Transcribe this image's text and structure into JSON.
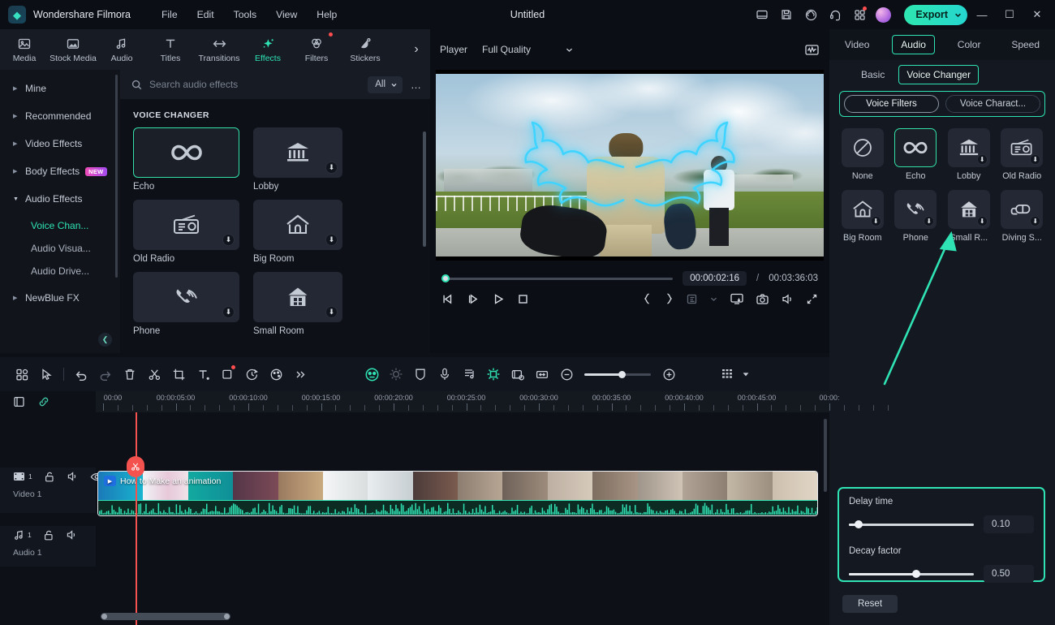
{
  "titlebar": {
    "brand": "Wondershare Filmora",
    "menus": [
      "File",
      "Edit",
      "Tools",
      "View",
      "Help"
    ],
    "document_title": "Untitled",
    "icons": [
      "panel-layout-icon",
      "save-icon",
      "cloud-upload-icon",
      "headset-support-icon",
      "apps-grid-icon"
    ],
    "export_label": "Export",
    "window_buttons": [
      "minimize",
      "maximize",
      "close"
    ]
  },
  "ribbon": {
    "tabs": [
      {
        "label": "Media",
        "icon": "media-icon",
        "active": false
      },
      {
        "label": "Stock Media",
        "icon": "stock-media-icon",
        "active": false
      },
      {
        "label": "Audio",
        "icon": "audio-note-icon",
        "active": false
      },
      {
        "label": "Titles",
        "icon": "titles-icon",
        "active": false
      },
      {
        "label": "Transitions",
        "icon": "transitions-icon",
        "active": false
      },
      {
        "label": "Effects",
        "icon": "effects-icon",
        "active": true
      },
      {
        "label": "Filters",
        "icon": "filters-icon",
        "active": false,
        "badge": true
      },
      {
        "label": "Stickers",
        "icon": "stickers-icon",
        "active": false
      }
    ],
    "more": "›"
  },
  "categories": [
    {
      "label": "Mine",
      "expanded": false
    },
    {
      "label": "Recommended",
      "expanded": false
    },
    {
      "label": "Video Effects",
      "expanded": false
    },
    {
      "label": "Body Effects",
      "expanded": false,
      "badge": "NEW"
    },
    {
      "label": "Audio Effects",
      "expanded": true
    },
    {
      "label": "NewBlue FX",
      "expanded": false
    }
  ],
  "subcategories": [
    {
      "label": "Voice Chan...",
      "active": true
    },
    {
      "label": "Audio Visua...",
      "active": false
    },
    {
      "label": "Audio Drive...",
      "active": false
    }
  ],
  "browser": {
    "search_placeholder": "Search audio effects",
    "search_value": "",
    "filter_label": "All",
    "section_title": "VOICE CHANGER",
    "effects": [
      {
        "label": "Echo",
        "icon": "infinity-icon",
        "selected": true,
        "download": false
      },
      {
        "label": "Lobby",
        "icon": "bank-columns-icon",
        "selected": false,
        "download": true
      },
      {
        "label": "Old Radio",
        "icon": "radio-icon",
        "selected": false,
        "download": true
      },
      {
        "label": "Big Room",
        "icon": "house-icon",
        "selected": false,
        "download": true
      },
      {
        "label": "Phone",
        "icon": "phone-ringing-icon",
        "selected": false,
        "download": true
      },
      {
        "label": "Small Room",
        "icon": "small-house-icon",
        "selected": false,
        "download": true
      }
    ]
  },
  "player": {
    "label": "Player",
    "quality": "Full Quality",
    "current_time": "00:00:02:16",
    "separator": "/",
    "total_time": "00:03:36:03",
    "controls": [
      "prev-frame",
      "next-frame",
      "play",
      "stop",
      "mark-in",
      "mark-out",
      "export-frame-menu",
      "screen-record",
      "snapshot",
      "volume",
      "fullscreen"
    ]
  },
  "right_panel": {
    "tabs": [
      {
        "label": "Video",
        "highlight": false
      },
      {
        "label": "Audio",
        "highlight": true
      },
      {
        "label": "Color",
        "highlight": false
      },
      {
        "label": "Speed",
        "highlight": false
      }
    ],
    "subtabs": [
      {
        "label": "Basic",
        "highlight": false
      },
      {
        "label": "Voice Changer",
        "highlight": true
      }
    ],
    "segments": [
      {
        "label": "Voice Filters",
        "selected": true
      },
      {
        "label": "Voice Charact...",
        "selected": false
      }
    ],
    "voices": [
      {
        "label": "None",
        "icon": "none-circle-slash-icon",
        "selected": false,
        "download": false
      },
      {
        "label": "Echo",
        "icon": "infinity-icon",
        "selected": true,
        "download": false
      },
      {
        "label": "Lobby",
        "icon": "bank-columns-icon",
        "selected": false,
        "download": true
      },
      {
        "label": "Old Radio",
        "icon": "radio-icon",
        "selected": false,
        "download": true
      },
      {
        "label": "Big Room",
        "icon": "house-icon",
        "selected": false,
        "download": true
      },
      {
        "label": "Phone",
        "icon": "phone-ringing-icon",
        "selected": false,
        "download": true
      },
      {
        "label": "Small R...",
        "icon": "small-house-icon",
        "selected": false,
        "download": true
      },
      {
        "label": "Diving S...",
        "icon": "diving-mask-icon",
        "selected": false,
        "download": true
      }
    ],
    "params": [
      {
        "name": "Delay time",
        "value": "0.10",
        "fraction": 0.06
      },
      {
        "name": "Decay factor",
        "value": "0.50",
        "fraction": 0.5
      }
    ],
    "reset_label": "Reset"
  },
  "timeline_toolbar": {
    "left_icons": [
      "project-media-icon",
      "select-cursor-icon"
    ],
    "edit_icons": [
      "undo-icon",
      "redo-icon",
      "delete-icon",
      "split-scissors-icon",
      "crop-icon",
      "text-icon",
      "mask-icon",
      "speed-clock-icon",
      "color-palette-icon",
      "more-chevrons-icon"
    ],
    "right_icons": [
      "face-detect-icon",
      "auto-enhance-icon",
      "stabilize-shield-icon",
      "microphone-icon",
      "audio-list-icon",
      "keyframe-icon",
      "render-preview-icon",
      "fit-timeline-icon"
    ],
    "zoom_out": "zoom-out-icon",
    "zoom_in": "zoom-in-icon",
    "grid_icon": "track-grid-icon",
    "caret_icon": "caret-down-icon"
  },
  "timeline": {
    "head_tools": [
      "add-track-icon",
      "link-icon"
    ],
    "ruler_labels": [
      "00:00",
      "00:00:05:00",
      "00:00:10:00",
      "00:00:15:00",
      "00:00:20:00",
      "00:00:25:00",
      "00:00:30:00",
      "00:00:35:00",
      "00:00:40:00",
      "00:00:45:00",
      "00:00:"
    ],
    "tracks": [
      {
        "name": "Video 1",
        "count": "1",
        "icons": [
          "video-track-icon",
          "unlock-icon",
          "mute-icon",
          "eye-icon"
        ]
      },
      {
        "name": "Audio 1",
        "count": "1",
        "icons": [
          "audio-track-icon",
          "unlock-icon",
          "mute-icon"
        ]
      }
    ],
    "clip_title": "How to Make an animation",
    "playhead_marker_icon": "scissors-icon"
  },
  "colors": {
    "accent": "#2fe3b4",
    "playhead": "#f4524e",
    "panel_bg": "#141820",
    "app_bg": "#0d1017",
    "annotation": "#2fe3b4"
  }
}
